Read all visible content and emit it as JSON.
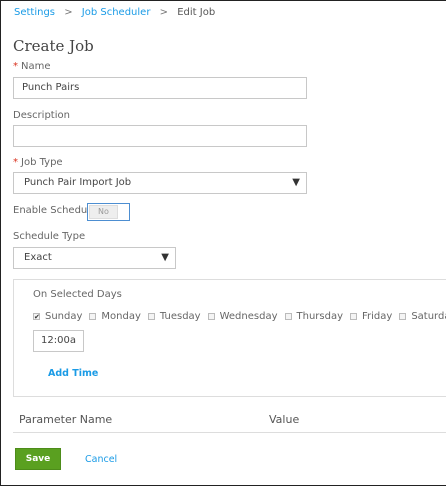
{
  "breadcrumb": {
    "items": [
      "Settings",
      "Job Scheduler"
    ],
    "current": "Edit Job",
    "separator": ">"
  },
  "page_title": "Create Job",
  "form": {
    "name": {
      "label": "Name",
      "value": "Punch Pairs"
    },
    "description": {
      "label": "Description",
      "value": ""
    },
    "job_type": {
      "label": "Job Type",
      "value": "Punch Pair Import Job"
    },
    "enable_schedule": {
      "label": "Enable Schedule",
      "value": "No"
    },
    "schedule_type": {
      "label": "Schedule Type",
      "value": "Exact"
    },
    "required_mark": "*"
  },
  "schedule": {
    "heading": "On Selected Days",
    "days": [
      {
        "label": "Sunday",
        "checked": true
      },
      {
        "label": "Monday",
        "checked": false
      },
      {
        "label": "Tuesday",
        "checked": false
      },
      {
        "label": "Wednesday",
        "checked": false
      },
      {
        "label": "Thursday",
        "checked": false
      },
      {
        "label": "Friday",
        "checked": false
      },
      {
        "label": "Saturday",
        "checked": false
      }
    ],
    "time": "12:00a",
    "add_time": "Add Time"
  },
  "parameters": {
    "columns": [
      "Parameter Name",
      "Value"
    ]
  },
  "actions": {
    "save": "Save",
    "cancel": "Cancel"
  },
  "colors": {
    "link": "#1a9be6",
    "save": "#5aa020",
    "required": "#d9301c"
  }
}
